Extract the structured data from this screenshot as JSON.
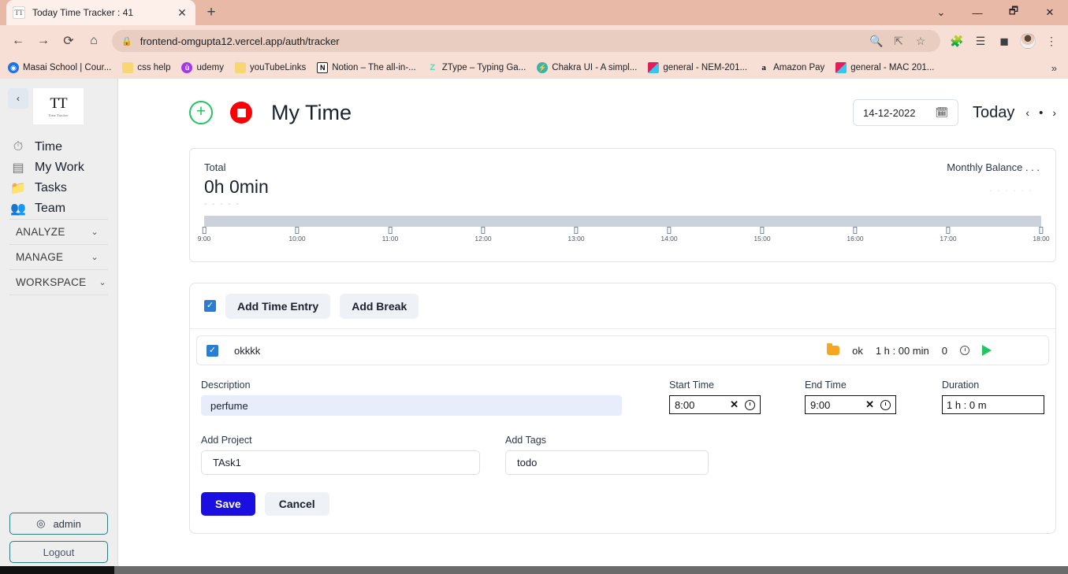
{
  "browser": {
    "tab": {
      "title": "Today Time Tracker : 41",
      "favicon": "TT",
      "close_icon": "close-icon"
    },
    "new_tab_label": "+",
    "window_controls": [
      "chevron-down",
      "minimize",
      "maximize",
      "close"
    ],
    "nav": {
      "back": "←",
      "forward": "→",
      "reload": "⟳",
      "home": "⌂"
    },
    "omnibox": {
      "lock": "lock-icon",
      "url": "frontend-omgupta12.vercel.app/auth/tracker",
      "zoom": "zoom-out-icon",
      "share": "share-icon",
      "bookmark": "star-icon"
    },
    "toolbar": {
      "extensions": "puzzle-icon",
      "reading_list": "reading-list-icon",
      "side_panel": "side-panel-icon",
      "profile": "avatar",
      "menu": "kebab-menu-icon"
    },
    "bookmarks": [
      {
        "label": "Masai School | Cour...",
        "icon": "globe-icon"
      },
      {
        "label": "css help",
        "icon": "folder-icon"
      },
      {
        "label": "udemy",
        "icon": "udemy-icon"
      },
      {
        "label": "youTubeLinks",
        "icon": "folder-icon"
      },
      {
        "label": "Notion – The all-in-...",
        "icon": "notion-icon"
      },
      {
        "label": "ZType – Typing Ga...",
        "icon": "ztype-icon"
      },
      {
        "label": "Chakra UI - A simpl...",
        "icon": "chakra-icon"
      },
      {
        "label": "general - NEM-201...",
        "icon": "slack-icon"
      },
      {
        "label": "Amazon Pay",
        "icon": "amazon-icon"
      },
      {
        "label": "general - MAC 201...",
        "icon": "slack-icon"
      }
    ],
    "bookmarks_overflow": "»"
  },
  "sidebar": {
    "collapse_icon": "‹",
    "logo": {
      "mark": "TT",
      "subtitle": "Time Tracker"
    },
    "items": [
      {
        "label": "Time",
        "icon": "stopwatch-icon"
      },
      {
        "label": "My Work",
        "icon": "list-icon"
      },
      {
        "label": "Tasks",
        "icon": "folder-icon"
      },
      {
        "label": "Team",
        "icon": "people-icon"
      }
    ],
    "sections": [
      {
        "label": "ANALYZE",
        "chevron": "⌄"
      },
      {
        "label": "MANAGE",
        "chevron": "⌄"
      },
      {
        "label": "WORKSPACE",
        "chevron": "⌄"
      }
    ],
    "account_button": {
      "label": "admin",
      "icon": "user-circle-icon"
    },
    "logout_button": {
      "label": "Logout"
    }
  },
  "header": {
    "add_icon": "plus-circle-icon",
    "stop_icon": "stop-record-icon",
    "title": "My Time",
    "date_value": "14-12-2022",
    "date_icon": "calendar-icon",
    "today_label": "Today",
    "prev_arrow": "‹",
    "dot": "•",
    "next_arrow": "›"
  },
  "total_card": {
    "label": "Total",
    "value": "0h 0min",
    "dashes": "- - - - -",
    "monthly_balance": "Monthly Balance . . .",
    "balance_dashes": "- - - - - -"
  },
  "chart_data": {
    "type": "bar",
    "title": "Total",
    "categories": [
      "9:00",
      "10:00",
      "11:00",
      "12:00",
      "13:00",
      "14:00",
      "15:00",
      "16:00",
      "17:00",
      "18:00"
    ],
    "values": [
      0,
      0,
      0,
      0,
      0,
      0,
      0,
      0,
      0,
      0
    ],
    "xlabel": "",
    "ylabel": "",
    "total_hours": 0,
    "total_minutes": 0,
    "axis_range": [
      "9:00",
      "18:00"
    ],
    "grid": false,
    "legend": false
  },
  "entries": {
    "select_all_checkbox": true,
    "add_time_entry_label": "Add Time Entry",
    "add_break_label": "Add Break",
    "rows": [
      {
        "checked": true,
        "description": "okkkk",
        "project_icon": "folder-icon",
        "project": "ok",
        "duration": "1 h : 00 min",
        "count": "0",
        "clock_icon": "clock-icon",
        "play_icon": "play-icon"
      }
    ]
  },
  "form": {
    "description_label": "Description",
    "description_value": "perfume",
    "start_time_label": "Start Time",
    "start_time_value": "8:00",
    "end_time_label": "End Time",
    "end_time_value": "9:00",
    "duration_label": "Duration",
    "duration_value": "1 h : 0 m",
    "clear_icon": "✕",
    "clock_icon": "clock-icon",
    "add_project_label": "Add Project",
    "add_project_value": "TAsk1",
    "add_tags_label": "Add Tags",
    "add_tags_value": "todo",
    "save_label": "Save",
    "cancel_label": "Cancel"
  },
  "colors": {
    "accent_blue": "#1a0fe0",
    "checkbox_blue": "#2b7cd3",
    "green": "#22c55e",
    "red": "#fb0007",
    "folder_orange": "#f5a623",
    "teal_border": "#2c7a7b",
    "chrome_bg": "#f7dfd5",
    "timeline_grey": "#ccd2dc"
  }
}
